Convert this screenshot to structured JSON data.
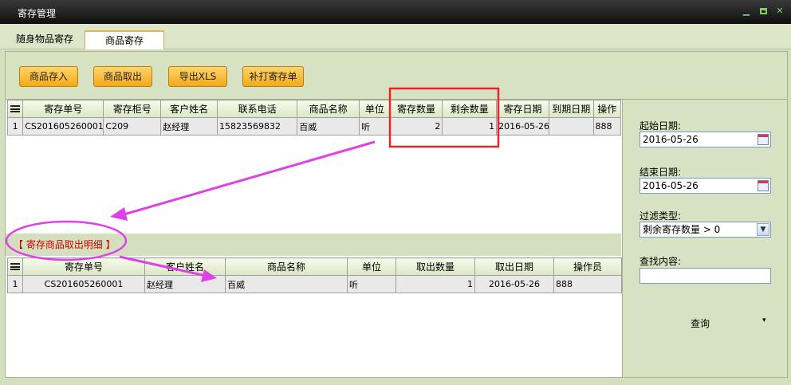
{
  "window": {
    "title": "寄存管理"
  },
  "tabs": [
    {
      "label": "随身物品寄存"
    },
    {
      "label": "商品寄存"
    }
  ],
  "toolbar": {
    "deposit": "商品存入",
    "takeout": "商品取出",
    "export": "导出XLS",
    "reprint": "补打寄存单"
  },
  "deposits": {
    "columns": [
      "寄存单号",
      "寄存柜号",
      "客户姓名",
      "联系电话",
      "商品名称",
      "单位",
      "寄存数量",
      "剩余数量",
      "寄存日期",
      "到期日期",
      "操作"
    ],
    "rows": [
      {
        "index": "1",
        "cells": [
          "CS201605260001",
          "C209",
          "赵经理",
          "15823569832",
          "百威",
          "听",
          "2",
          "1",
          "2016-05-26",
          "",
          "888"
        ]
      }
    ]
  },
  "detail": {
    "header": "【  寄存商品取出明细  】",
    "columns": [
      "寄存单号",
      "客户姓名",
      "商品名称",
      "单位",
      "取出数量",
      "取出日期",
      "操作员"
    ],
    "rows": [
      {
        "index": "1",
        "cells": [
          "CS201605260001",
          "赵经理",
          "百威",
          "听",
          "1",
          "2016-05-26",
          "888"
        ]
      }
    ]
  },
  "filter": {
    "start_label": "起始日期:",
    "start_value": "2016-05-26",
    "end_label": "结束日期:",
    "end_value": "2016-05-26",
    "type_label": "过滤类型:",
    "type_value": "剩余寄存数量 > 0",
    "search_label": "查找内容:",
    "search_value": "",
    "query_label": "查询"
  },
  "colors": {
    "annotation_red": "#e8262a",
    "annotation_magenta": "#e040e8",
    "detail_header_text": "#d40000"
  }
}
